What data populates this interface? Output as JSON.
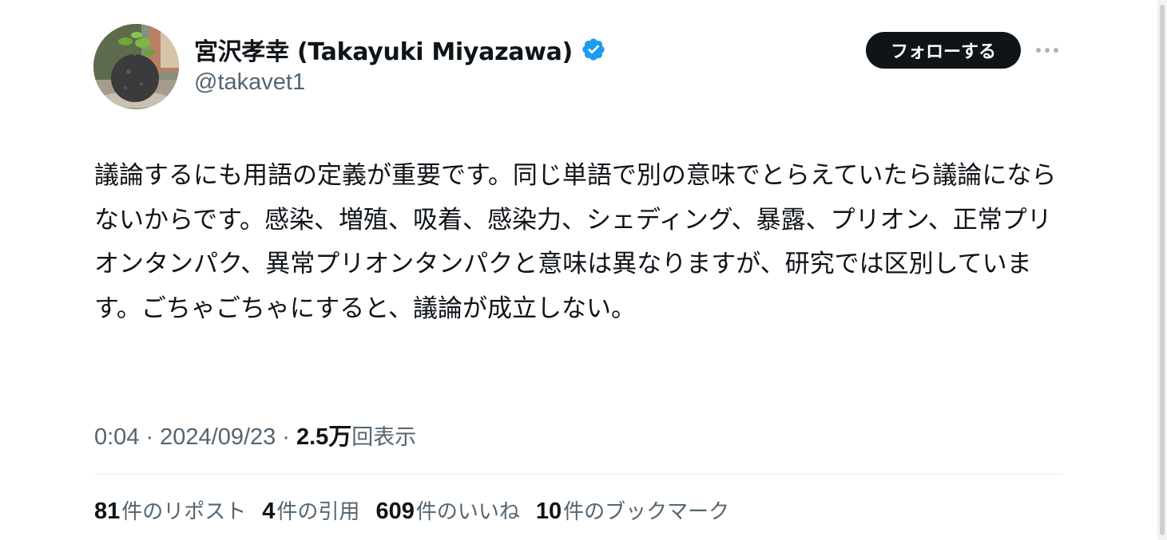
{
  "author": {
    "display_name": "宮沢孝幸 (Takayuki Miyazawa)",
    "handle": "@takavet1",
    "verified_icon": "verified-badge-icon",
    "verified_color": "#1d9bf0"
  },
  "actions": {
    "follow_label": "フォローする",
    "more_icon": "more-horizontal-icon"
  },
  "tweet": {
    "text": "議論するにも用語の定義が重要です。同じ単語で別の意味でとらえていたら議論にならないからです。感染、増殖、吸着、感染力、シェディング、暴露、プリオン、正常プリオンタンパク、異常プリオンタンパクと意味は異なりますが、研究では区別しています。ごちゃごちゃにすると、議論が成立しない。"
  },
  "meta": {
    "time": "0:04",
    "separator": "·",
    "date": "2024/09/23",
    "views_count": "2.5万",
    "views_label": "回表示"
  },
  "stats": [
    {
      "count": "81",
      "label": "件のリポスト"
    },
    {
      "count": "4",
      "label": "件の引用"
    },
    {
      "count": "609",
      "label": "件のいいね"
    },
    {
      "count": "10",
      "label": "件のブックマーク"
    }
  ],
  "colors": {
    "text_primary": "#0f1419",
    "text_secondary": "#536471",
    "follow_bg": "#0f1419",
    "divider": "#e6e9ec"
  }
}
